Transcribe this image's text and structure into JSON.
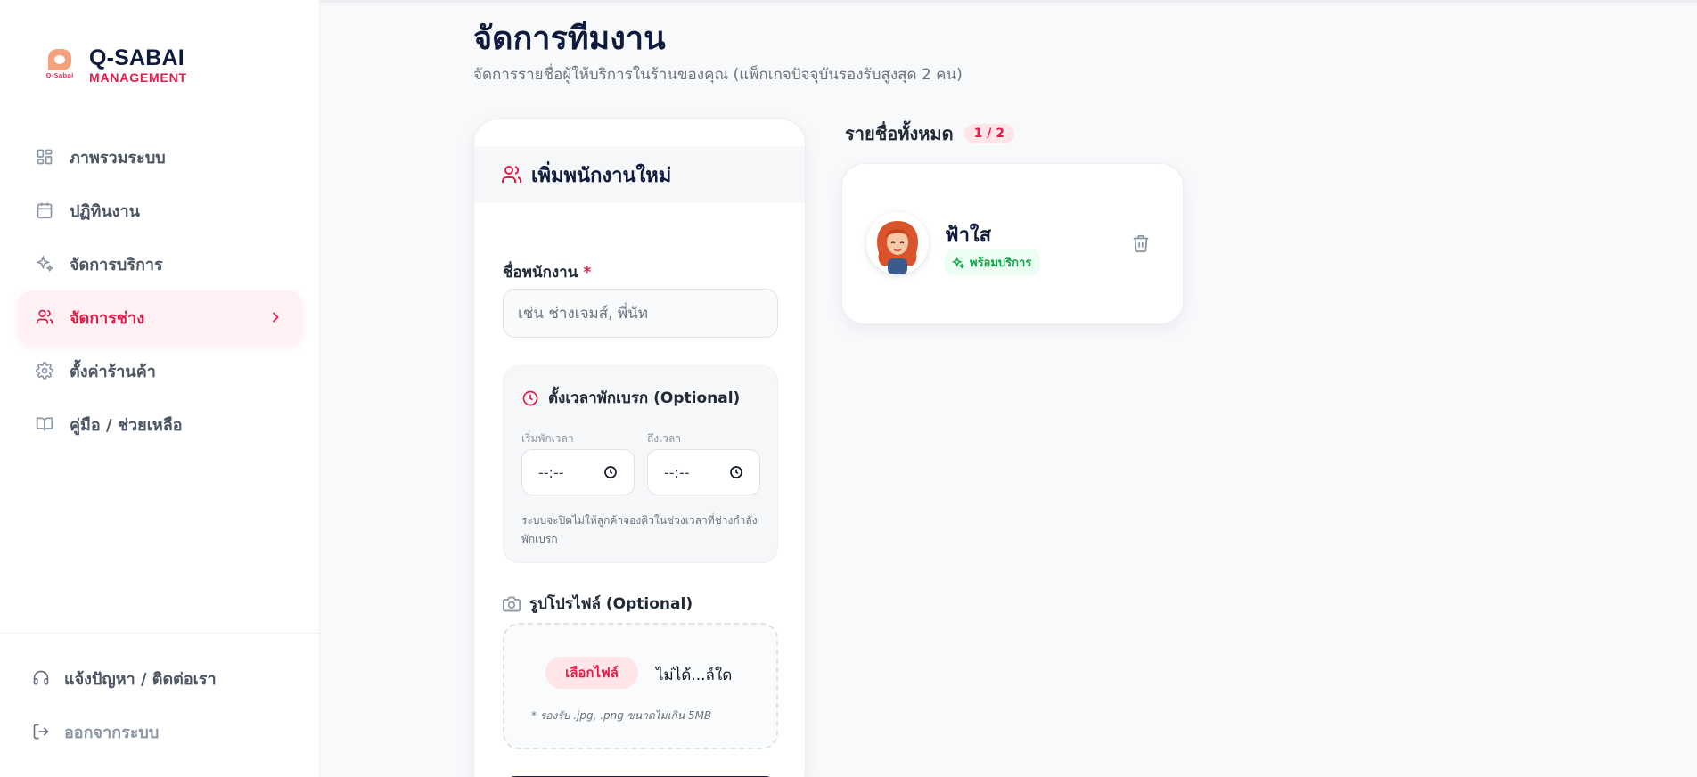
{
  "brand": {
    "name": "Q-SABAI",
    "sub": "MANAGEMENT",
    "logo_text": "Q-Sabai"
  },
  "nav": {
    "items": [
      {
        "label": "ภาพรวมระบบ",
        "icon": "dashboard-icon"
      },
      {
        "label": "ปฏิทินงาน",
        "icon": "calendar-icon"
      },
      {
        "label": "จัดการบริการ",
        "icon": "sparkles-icon"
      },
      {
        "label": "จัดการช่าง",
        "icon": "users-icon",
        "active": true
      },
      {
        "label": "ตั้งค่าร้านค้า",
        "icon": "gear-icon"
      },
      {
        "label": "คู่มือ / ช่วยเหลือ",
        "icon": "book-icon"
      }
    ]
  },
  "sidebar_bottom": {
    "support": "แจ้งปัญหา / ติดต่อเรา",
    "logout": "ออกจากระบบ"
  },
  "header": {
    "title": "จัดการทีมงาน",
    "subtitle": "จัดการรายชื่อผู้ให้บริการในร้านของคุณ (แพ็กเกจปัจจุบันรองรับสูงสุด 2 คน)"
  },
  "form": {
    "title": "เพิ่มพนักงานใหม่",
    "name_label": "ชื่อพนักงาน",
    "required_mark": "*",
    "name_placeholder": "เช่น ช่างเจมส์, พี่นัท",
    "name_value": "",
    "break": {
      "title": "ตั้งเวลาพักเบรก (Optional)",
      "start_label": "เริ่มพักเวลา",
      "end_label": "ถึงเวลา",
      "start_value": "--:--",
      "end_value": "--:--",
      "note": "ระบบจะปิดไม่ให้ลูกค้าจองคิวในช่วงเวลาที่ช่างกำลังพักเบรก"
    },
    "photo": {
      "label": "รูปโปรไฟล์ (Optional)",
      "button": "เลือกไฟล์",
      "status": "ไม่ได้...ล์ใด",
      "hint": "* รองรับ .jpg, .png ขนาดไม่เกิน 5MB"
    }
  },
  "list": {
    "title": "รายชื่อทั้งหมด",
    "count": "1 / 2",
    "staff": [
      {
        "name": "ฟ้าใส",
        "status": "พร้อมบริการ"
      }
    ]
  },
  "colors": {
    "accent": "#e11d48",
    "accent_soft": "#ffe4e8",
    "navy": "#0f1b3d",
    "success": "#16a34a"
  }
}
